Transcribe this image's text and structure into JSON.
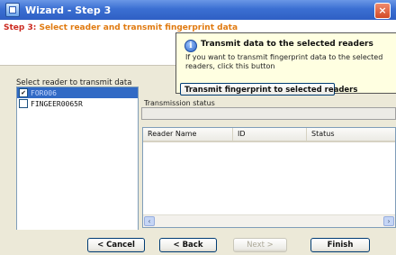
{
  "window": {
    "title": "Wizard - Step 3",
    "close_glyph": "×"
  },
  "header": {
    "step_lead": "Step 3:",
    "step_text": "Select reader and transmit fingerprint data"
  },
  "balloon": {
    "title": "Transmit data to the selected readers",
    "body": "If you want to transmit fingerprint data to the selected readers, click this button",
    "icon": "info-icon"
  },
  "reader_list": {
    "label": "Select reader to transmit data",
    "items": [
      {
        "name": "FOR006",
        "checked": "✔",
        "selected": true
      },
      {
        "name": "FINGEER0065R",
        "checked": "",
        "selected": false
      }
    ]
  },
  "transmit_button": {
    "label": "Transmit fingerprint to selected readers"
  },
  "status": {
    "label": "Transmission status",
    "value": ""
  },
  "table": {
    "columns": [
      "Reader Name",
      "ID",
      "Status"
    ],
    "rows": [],
    "scroll_left": "‹",
    "scroll_right": "›"
  },
  "footer": {
    "cancel": "< Cancel",
    "back": "< Back",
    "next": "Next >",
    "finish": "Finish"
  }
}
